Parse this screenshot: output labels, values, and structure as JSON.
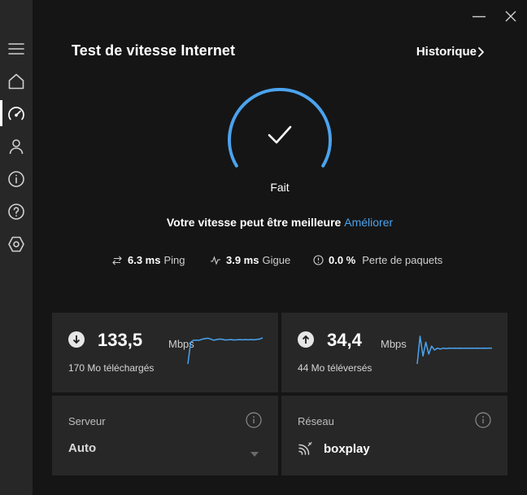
{
  "app": {
    "title": "Test de vitesse Internet",
    "history_label": "Historique"
  },
  "window": {
    "minimize_icon": "minimize-icon",
    "close_icon": "close-icon"
  },
  "sidebar": {
    "items": [
      {
        "icon": "hamburger-menu-icon"
      },
      {
        "icon": "home-icon"
      },
      {
        "icon": "speedometer-icon",
        "active": true
      },
      {
        "icon": "person-icon"
      },
      {
        "icon": "info-icon"
      },
      {
        "icon": "help-icon"
      },
      {
        "icon": "settings-hexagon-icon"
      }
    ]
  },
  "result": {
    "status": "Fait",
    "message": "Votre vitesse peut être meilleure",
    "improve_link": "Améliorer",
    "gauge_icon": "checkmark-icon"
  },
  "metrics": {
    "ping": {
      "value": "6.3 ms",
      "label": "Ping"
    },
    "jitter": {
      "value": "3.9 ms",
      "label": "Gigue"
    },
    "loss": {
      "value": "0.0 %",
      "label": "Perte de paquets"
    }
  },
  "download": {
    "value": "133,5",
    "unit": "Mbps",
    "subtitle": "170 Mo téléchargés",
    "series": [
      0,
      11,
      12,
      12,
      12,
      12.5,
      12.8,
      13,
      12.5,
      12,
      12.3,
      12.6,
      12.4,
      12.1,
      12.2,
      12.3,
      12.1,
      12.2,
      12.3,
      12.2,
      12.3,
      12.2,
      12.3,
      12.2,
      12.4,
      12.6,
      13.2
    ]
  },
  "upload": {
    "value": "34,4",
    "unit": "Mbps",
    "subtitle": "44 Mo téléversés",
    "series": [
      0,
      14,
      4,
      11,
      5,
      9,
      7,
      8,
      7.5,
      8,
      7.8,
      8,
      7.9,
      8,
      7.9,
      8,
      7.9,
      8,
      7.9,
      8,
      7.9,
      8,
      7.9,
      8,
      7.9,
      8,
      8
    ]
  },
  "server": {
    "label": "Serveur",
    "value": "Auto"
  },
  "network": {
    "label": "Réseau",
    "value": "boxplay",
    "icon": "wifi-network-icon"
  },
  "colors": {
    "accent": "#4ba3ee",
    "background": "#151515",
    "card": "#272727",
    "sidebar": "#272727"
  }
}
